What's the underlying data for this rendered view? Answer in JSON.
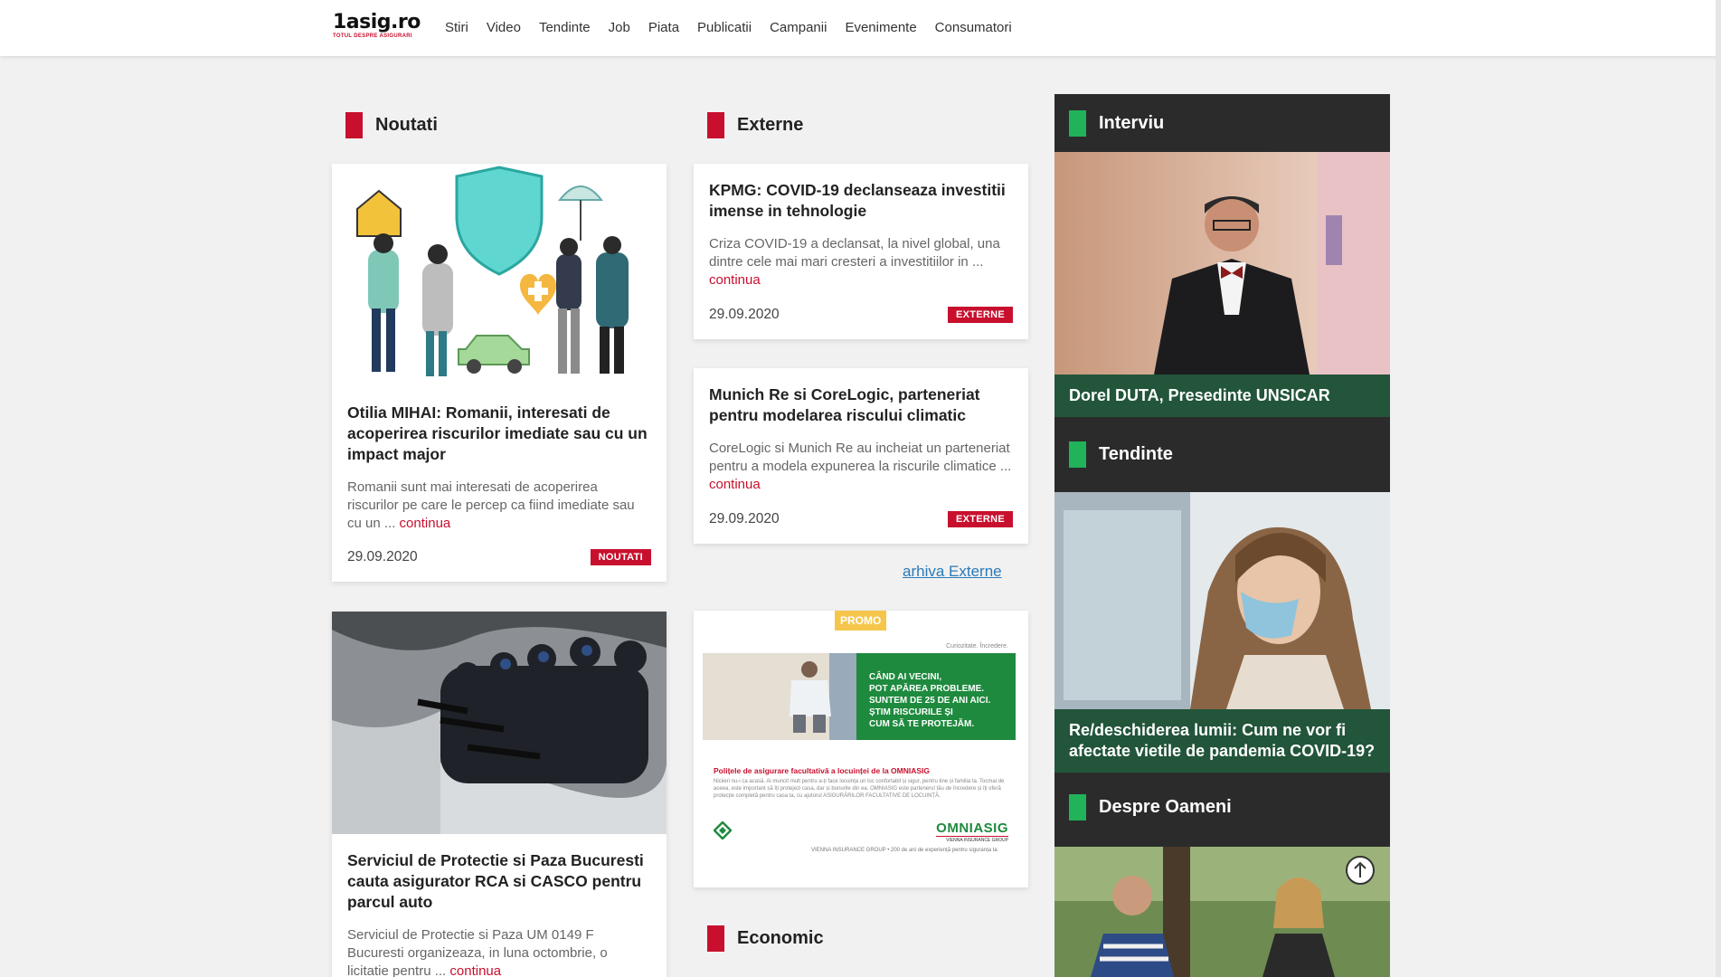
{
  "site": {
    "logo_text": "1asig.ro",
    "logo_tagline": "TOTUL DESPRE ASIGURARI"
  },
  "nav": [
    "Stiri",
    "Video",
    "Tendinte",
    "Job",
    "Piata",
    "Publicatii",
    "Campanii",
    "Evenimente",
    "Consumatori"
  ],
  "noutati": {
    "heading": "Noutati",
    "articles": [
      {
        "title": "Otilia MIHAI: Romanii, interesati de acoperirea riscurilor imediate sau cu un impact major",
        "excerpt": "Romanii sunt mai interesati de acoperirea riscurilor pe care le percep ca fiind imediate sau cu un ...",
        "more": "continua",
        "date": "29.09.2020",
        "badge": "NOUTATI"
      },
      {
        "title": "Serviciul de Protectie si Paza Bucuresti cauta asigurator RCA si CASCO pentru parcul auto",
        "excerpt": "Serviciul de Protectie si Paza UM 0149 F Bucuresti organizeaza, in luna octombrie, o licitatie pentru ...",
        "more": "continua"
      }
    ]
  },
  "externe": {
    "heading": "Externe",
    "articles": [
      {
        "title": "KPMG: COVID-19 declanseaza investitii imense in tehnologie",
        "excerpt": "Criza COVID-19 a declansat, la nivel global, una dintre cele mai mari cresteri a investitiilor in ...",
        "more": "continua",
        "date": "29.09.2020",
        "badge": "EXTERNE"
      },
      {
        "title": "Munich Re si CoreLogic, parteneriat pentru modelarea riscului climatic",
        "excerpt": "CoreLogic si Munich Re au incheiat un parteneriat pentru a modela expunerea la riscurile climatice ...",
        "more": "continua",
        "date": "29.09.2020",
        "badge": "EXTERNE"
      }
    ],
    "archive_link": "arhiva Externe"
  },
  "promo": {
    "badge": "PROMO",
    "corner": "Curiozitate. Încredere.",
    "headline_lines": [
      "CÂND AI VECINI,",
      "POT APĂREA PROBLEME.",
      "SUNTEM DE 25 DE ANI AICI.",
      "ȘTIM RISCURILE ȘI",
      "CUM SĂ TE PROTEJĂM."
    ],
    "subhead": "Polițele de asigurare facultativă a locuinței de la OMNIASIG",
    "body": "Niciieri nu-i ca acasă. Ai muncit mult pentru a-ți face locuința un loc confortabil și sigur, pentru tine și familia ta. Tocmai de aceea, este important să îți protejezi casa, dar și bunurile din ea. OMNIASIG este partenerul tău de încredere și îți oferă protecție completă pentru casa ta, cu ajutorul ASIGURĂRILOR FACULTATIVE DE LOCUINȚĂ.",
    "brand": "OMNIASIG",
    "brand_sub": "VIENNA INSURANCE GROUP",
    "footer": "VIENNA INSURANCE GROUP • 200 de ani de experiență pentru siguranța ta"
  },
  "economic": {
    "heading": "Economic"
  },
  "sidebar": {
    "sections": [
      {
        "heading": "Interviu",
        "caption": "Dorel DUTA, Presedinte UNSICAR"
      },
      {
        "heading": "Tendinte",
        "caption": "Re/deschiderea lumii: Cum ne vor fi afectate vietile de pandemia COVID-19?"
      },
      {
        "heading": "Despre Oameni"
      }
    ]
  },
  "colors": {
    "accent_red": "#c8102e",
    "accent_green": "#21b35a",
    "sidebar_bg": "#2b2b2b",
    "caption_green": "#22553a",
    "link_blue": "#2a7ab8"
  }
}
